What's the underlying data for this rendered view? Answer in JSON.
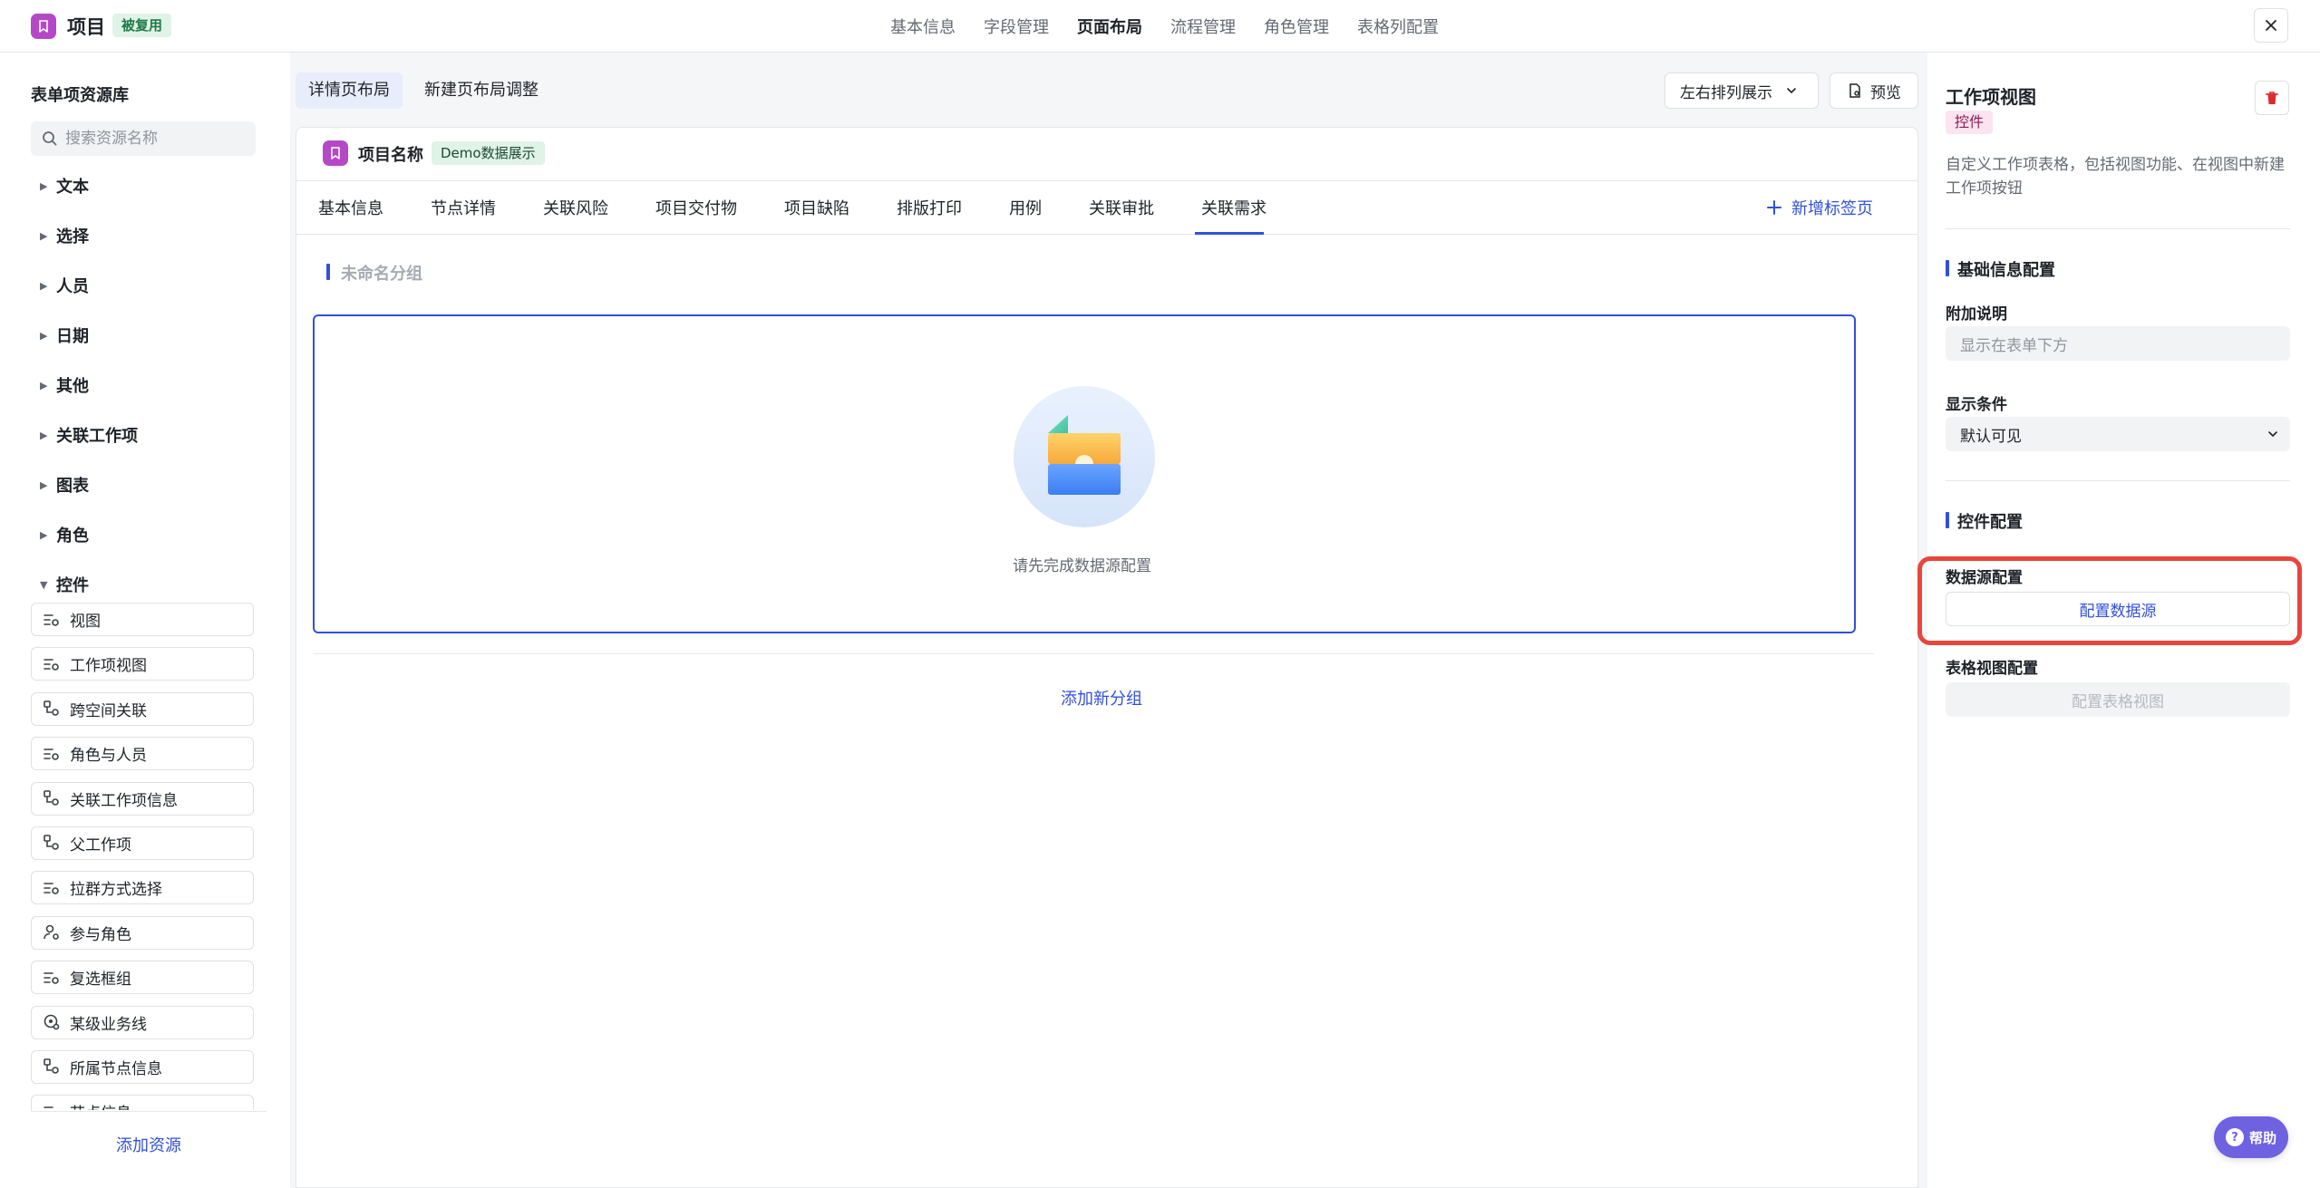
{
  "header": {
    "app_title": "项目",
    "reuse_badge": "被复用",
    "nav_tabs": [
      "基本信息",
      "字段管理",
      "页面布局",
      "流程管理",
      "角色管理",
      "表格列配置"
    ],
    "active_nav": "页面布局"
  },
  "sidebar": {
    "title": "表单项资源库",
    "search_placeholder": "搜索资源名称",
    "categories": [
      "文本",
      "选择",
      "人员",
      "日期",
      "其他",
      "关联工作项",
      "图表",
      "角色",
      "控件"
    ],
    "expanded_category": "控件",
    "controls": [
      "视图",
      "工作项视图",
      "跨空间关联",
      "角色与人员",
      "关联工作项信息",
      "父工作项",
      "拉群方式选择",
      "参与角色",
      "复选框组",
      "某级业务线",
      "所属节点信息",
      "节点信息"
    ],
    "add_resource": "添加资源"
  },
  "center": {
    "layout_tabs": [
      "详情页布局",
      "新建页布局调整"
    ],
    "arrange_select": "左右排列展示",
    "preview": "预览",
    "card_name": "项目名称",
    "demo_badge": "Demo数据展示",
    "sub_tabs": [
      "基本信息",
      "节点详情",
      "关联风险",
      "项目交付物",
      "项目缺陷",
      "排版打印",
      "用例",
      "关联审批",
      "关联需求"
    ],
    "active_sub_tab": "关联需求",
    "new_tab": "新增标签页",
    "group_title": "未命名分组",
    "empty_text": "请先完成数据源配置",
    "add_group": "添加新分组"
  },
  "right_panel": {
    "title": "工作项视图",
    "badge": "控件",
    "description": "自定义工作项表格，包括视图功能、在视图中新建工作项按钮",
    "basic_section": "基础信息配置",
    "extra_label": "附加说明",
    "extra_placeholder": "显示在表单下方",
    "condition_label": "显示条件",
    "condition_value": "默认可见",
    "control_section": "控件配置",
    "datasource_label": "数据源配置",
    "datasource_button": "配置数据源",
    "tableview_label": "表格视图配置",
    "tableview_button": "配置表格视图"
  },
  "help": "帮助",
  "colors": {
    "accent": "#3250d8",
    "brand_logo": "#b548c6",
    "highlight": "#e8453c",
    "help_button": "#6f62e0"
  }
}
